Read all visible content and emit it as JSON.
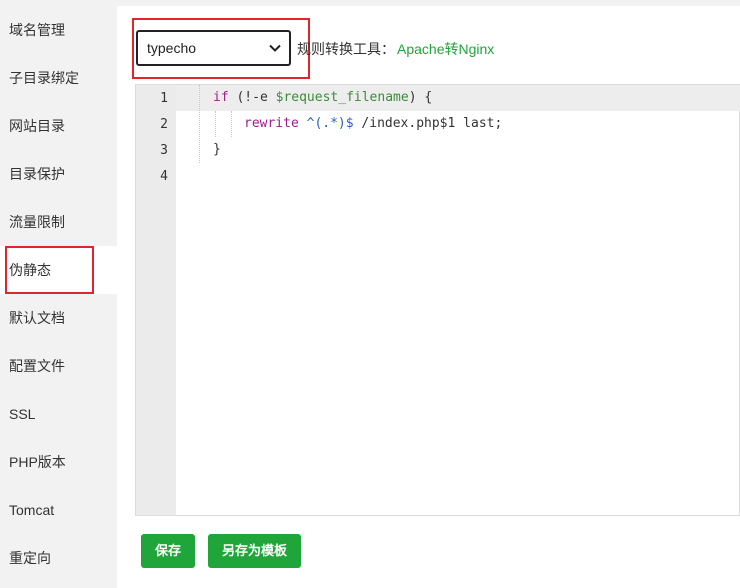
{
  "sidebar": {
    "items": [
      {
        "label": "域名管理"
      },
      {
        "label": "子目录绑定"
      },
      {
        "label": "网站目录"
      },
      {
        "label": "目录保护"
      },
      {
        "label": "流量限制"
      },
      {
        "label": "伪静态"
      },
      {
        "label": "默认文档"
      },
      {
        "label": "配置文件"
      },
      {
        "label": "SSL"
      },
      {
        "label": "PHP版本"
      },
      {
        "label": "Tomcat"
      },
      {
        "label": "重定向"
      }
    ],
    "active_label": "伪静态"
  },
  "rewrite": {
    "select_value": "typecho",
    "tool_label": "规则转换工具：",
    "tool_link": "Apache转Nginx"
  },
  "editor": {
    "line_numbers": [
      "1",
      "2",
      "3",
      "4"
    ],
    "lines": {
      "l1_kw": "if",
      "l1_a": " (!-e ",
      "l1_var": "$request_filename",
      "l1_b": ") {",
      "l2_fn": "rewrite",
      "l2_sp": " ",
      "l2_rx": "^(.*)$",
      "l2_rest": " /index.php$1 last;",
      "l3": "}",
      "l4": ""
    }
  },
  "buttons": {
    "save": "保存",
    "save_as_template": "另存为模板"
  },
  "colors": {
    "accent": "#20a53a",
    "highlight": "#e0262d"
  }
}
